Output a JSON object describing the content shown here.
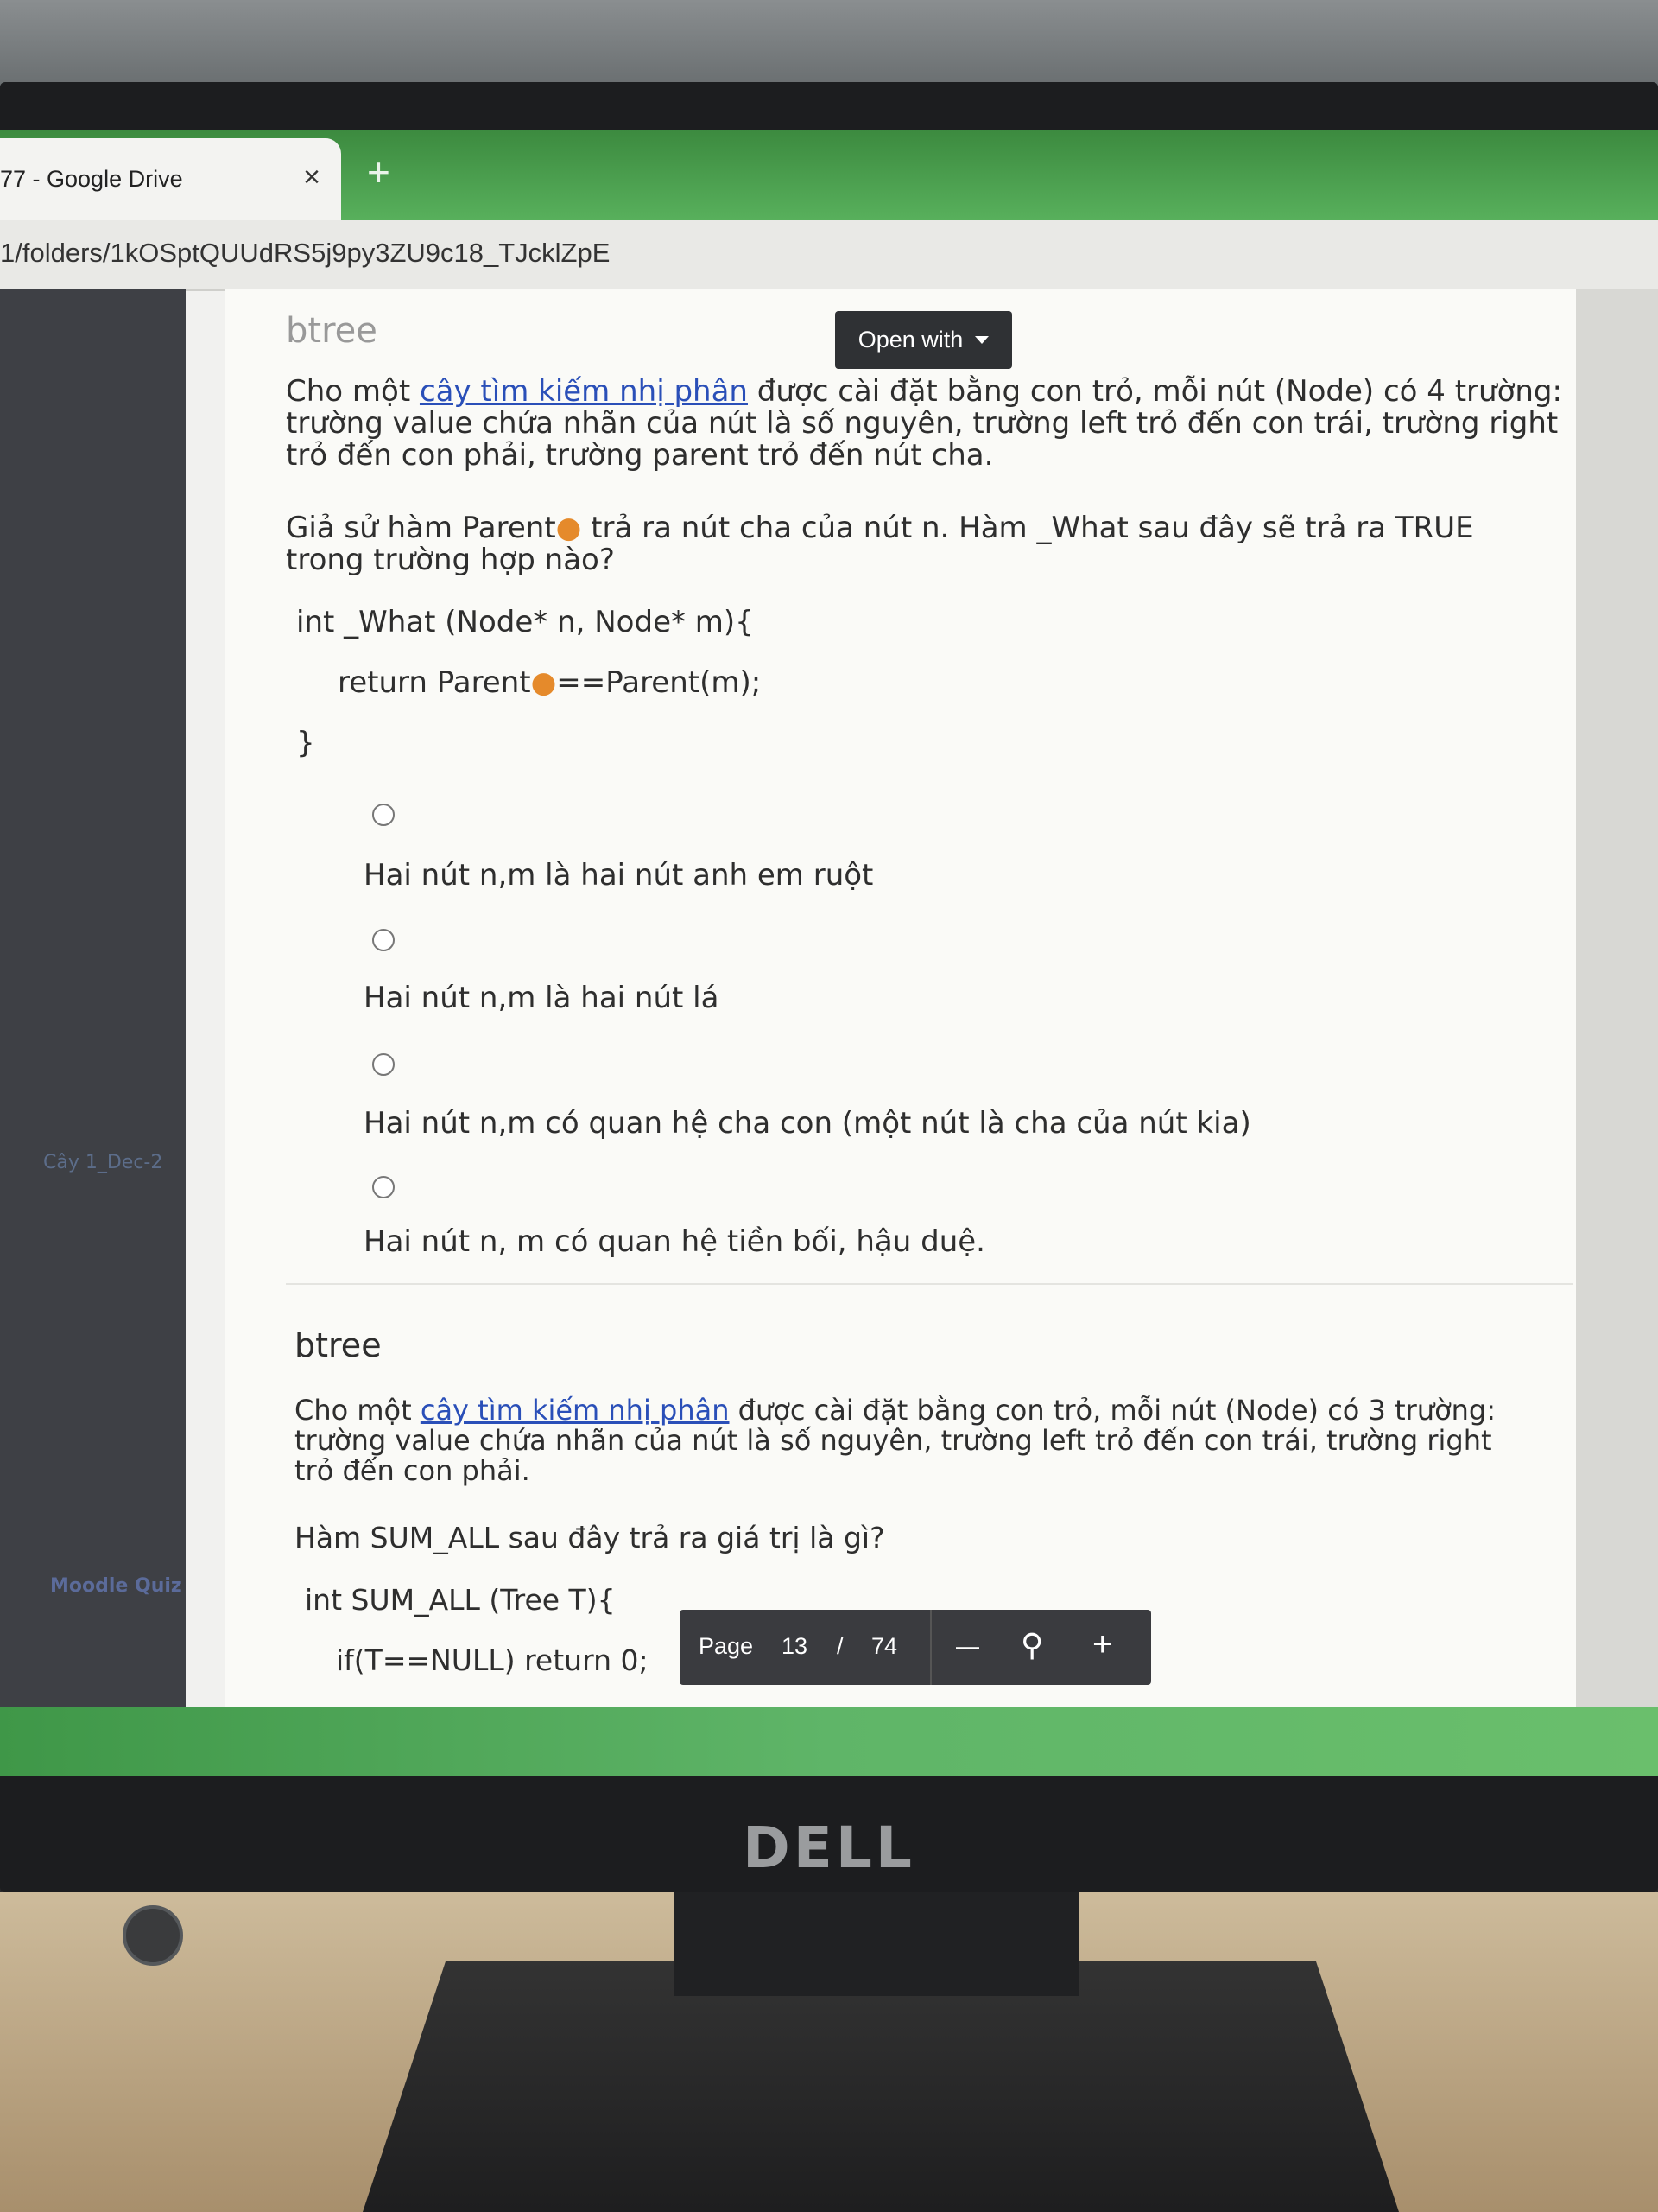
{
  "browser": {
    "tab_title": "77 - Google Drive",
    "tab_close": "×",
    "new_tab": "+",
    "address": "1/folders/1kOSptQUUdRS5j9py3ZU9c18_TJcklZpE"
  },
  "sidebar": {
    "items": [
      {
        "label": "Cây 1_Dec-2"
      },
      {
        "label": "Moodle Quiz"
      }
    ]
  },
  "viewer": {
    "open_with": "Open with",
    "pager": {
      "label": "Page",
      "current": "13",
      "separator": "/",
      "total": "74",
      "zoom_out": "—",
      "zoom_in": "+"
    }
  },
  "question1": {
    "title": "btree",
    "intro_pre": "Cho một ",
    "intro_link": "cây tìm kiếm nhị phân",
    "intro_post": " được cài đặt bằng con trỏ, mỗi nút (Node) có 4 trường:",
    "line2": "trường value chứa nhãn của nút là số nguyên, trường left trỏ đến con trái, trường right",
    "line3": "trỏ đến con phải, trường parent trỏ đến nút cha.",
    "prompt_a": "Giả sử hàm Parent",
    "prompt_b": " trả ra nút cha của nút n. Hàm _What sau đây sẽ trả ra TRUE",
    "prompt_c": "trong trường hợp nào?",
    "code_line1": "int   _What (Node* n, Node* m){",
    "code_line2": "return Parent",
    "code_line2b": "==Parent(m);",
    "code_line3": "}",
    "options": [
      "Hai nút n,m là hai nút anh em ruột",
      "Hai nút n,m là hai nút lá",
      "Hai nút n,m có quan hệ cha con (một nút là cha của nút kia)",
      "Hai nút n, m có quan hệ tiền bối, hậu duệ."
    ]
  },
  "question2": {
    "title": "btree",
    "intro_pre": "Cho một ",
    "intro_link": "cây tìm kiếm nhị phân",
    "intro_post": " được cài đặt bằng con trỏ, mỗi nút (Node) có 3 trường:",
    "line2": "trường value chứa nhãn của nút là số nguyên, trường left trỏ đến con trái, trường right",
    "line3": "trỏ đến con phải.",
    "prompt": "Hàm SUM_ALL sau đây trả ra giá trị là gì?",
    "code_line1": "int SUM_ALL (Tree T){",
    "code_line2": "if(T==NULL) return 0;"
  },
  "monitor": {
    "brand": "DELL"
  },
  "colors": {
    "tab_green": "#58b05c",
    "link": "#2a4fb8",
    "pager_bg": "#3a3b3f"
  }
}
